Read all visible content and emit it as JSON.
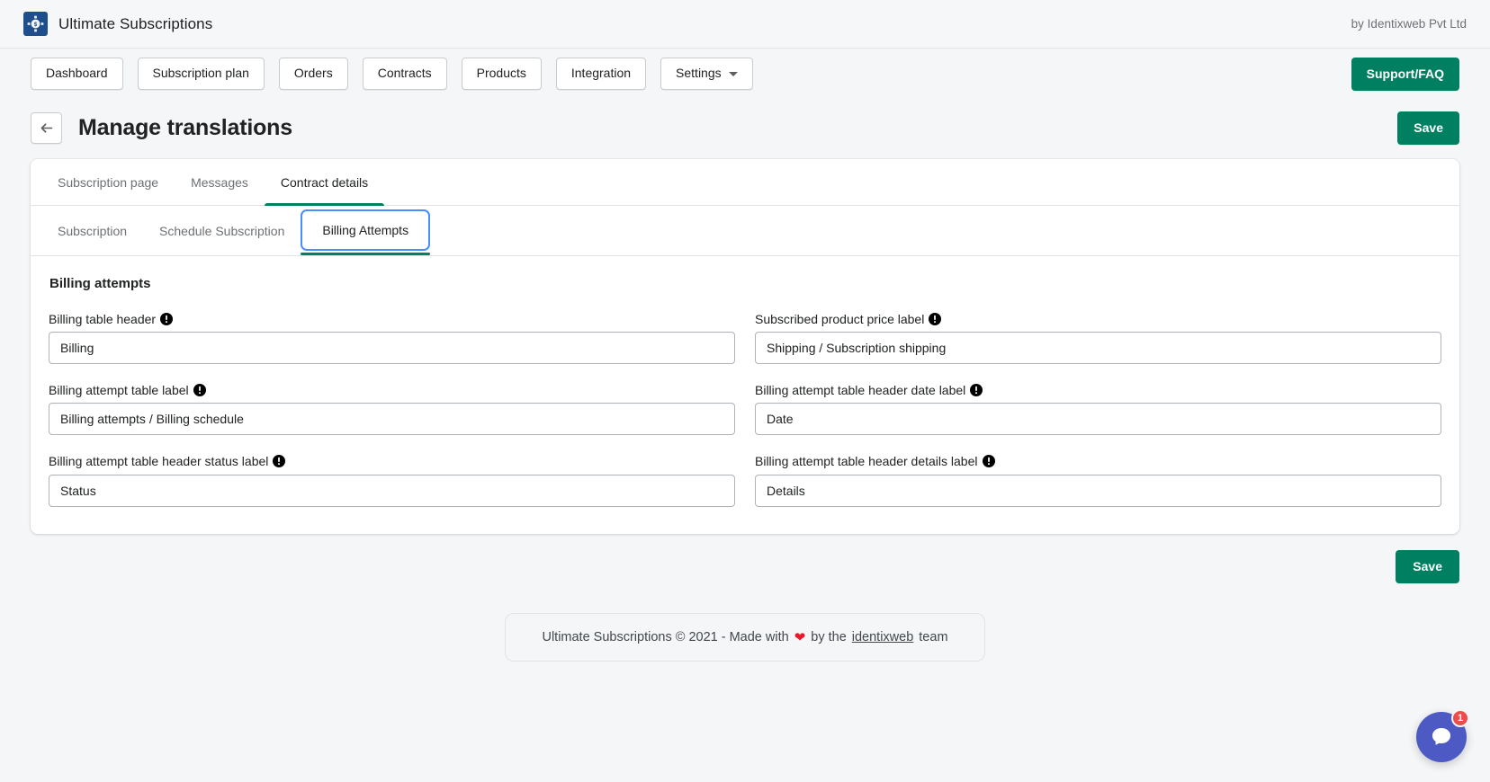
{
  "appbar": {
    "logo_icon": "subscriptions-logo-icon",
    "title": "Ultimate Subscriptions",
    "by_text": "by Identixweb Pvt Ltd"
  },
  "nav": {
    "items": [
      {
        "label": "Dashboard",
        "has_caret": false
      },
      {
        "label": "Subscription plan",
        "has_caret": false
      },
      {
        "label": "Orders",
        "has_caret": false
      },
      {
        "label": "Contracts",
        "has_caret": false
      },
      {
        "label": "Products",
        "has_caret": false
      },
      {
        "label": "Integration",
        "has_caret": false
      },
      {
        "label": "Settings",
        "has_caret": true
      }
    ],
    "support_label": "Support/FAQ"
  },
  "page_header": {
    "back_icon": "arrow-left-icon",
    "title": "Manage translations",
    "save_label": "Save"
  },
  "tabs_primary": [
    {
      "label": "Subscription page",
      "active": false
    },
    {
      "label": "Messages",
      "active": false
    },
    {
      "label": "Contract details",
      "active": true
    }
  ],
  "tabs_secondary": [
    {
      "label": "Subscription",
      "active": false
    },
    {
      "label": "Schedule Subscription",
      "active": false
    },
    {
      "label": "Billing Attempts",
      "active": true
    }
  ],
  "form": {
    "section_title": "Billing attempts",
    "info_icon": "info-exclamation-icon",
    "fields": [
      {
        "label": "Billing table header",
        "value": "Billing"
      },
      {
        "label": "Subscribed product price label",
        "value": "Shipping / Subscription shipping"
      },
      {
        "label": "Billing attempt table label",
        "value": "Billing attempts / Billing schedule"
      },
      {
        "label": "Billing attempt table header date label",
        "value": "Date"
      },
      {
        "label": "Billing attempt table header status label",
        "value": "Status"
      },
      {
        "label": "Billing attempt table header details label",
        "value": "Details"
      }
    ]
  },
  "bottom": {
    "save_label": "Save"
  },
  "footer": {
    "prefix": "Ultimate Subscriptions © 2021 - Made with",
    "heart_icon": "heart-icon",
    "middle": "by the",
    "link": "identixweb",
    "suffix": "team"
  },
  "chat": {
    "icon": "chat-bubble-icon",
    "badge_count": "1"
  },
  "colors": {
    "accent_green": "#008060",
    "focus_blue": "#458fff",
    "chat_blue": "#4e5ac4",
    "badge_red": "#ef4b4b",
    "heart_red": "#e8192c",
    "page_bg": "#f4f6f8"
  }
}
